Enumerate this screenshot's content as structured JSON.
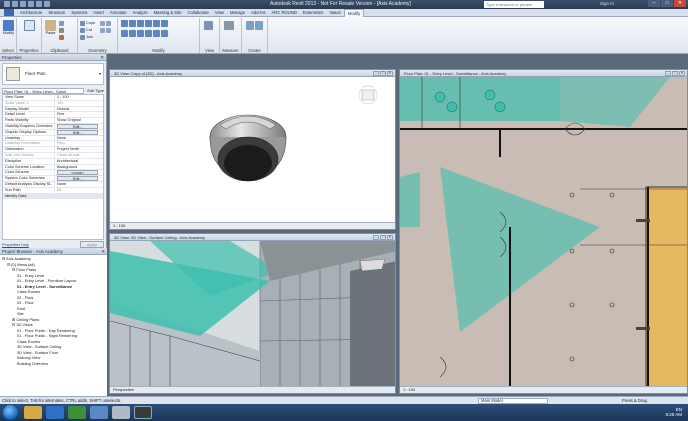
{
  "window": {
    "title": "Autodesk Revit 2013 - Not For Resale Version - [Axis Academy]",
    "search_placeholder": "Type a keyword or phrase",
    "sign_in": "Sign In",
    "close": "✕",
    "minimize": "–",
    "maximize": "□"
  },
  "tabs": [
    "Architecture",
    "Structure",
    "Systems",
    "Insert",
    "Annotate",
    "Analyze",
    "Massing & Site",
    "Collaborate",
    "View",
    "Manage",
    "Add-Ins",
    "ARC ROUND",
    "Extensions",
    "Vasari",
    "Modify"
  ],
  "active_tab": "Modify",
  "ribbon": {
    "select_label": "Select",
    "modify_label": "Modify",
    "properties_label": "Properties",
    "clipboard_label": "Clipboard",
    "geometry_label": "Geometry",
    "modify_group_label": "Modify",
    "view_label": "View",
    "measure_label": "Measure",
    "create_label": "Create",
    "copy_label": "Cope",
    "cut_label": "Cut",
    "join_label": "Join",
    "paste_label": "Paste"
  },
  "properties_panel": {
    "title": "Properties",
    "type_name": "Floor Plan",
    "instance_select": "Floor Plan: 01 - Entry Level - Surve",
    "edit_type": "Edit Type",
    "rows": [
      {
        "k": "View Scale",
        "v": "1 : 100",
        "dim": false
      },
      {
        "k": "Scale Value    1:",
        "v": "100",
        "dim": true
      },
      {
        "k": "Display Model",
        "v": "Normal",
        "dim": false
      },
      {
        "k": "Detail Level",
        "v": "Fine",
        "dim": false
      },
      {
        "k": "Parts Visibility",
        "v": "Show Original",
        "dim": false
      },
      {
        "k": "Visibility/Graphics Overrides",
        "v": "Edit...",
        "btn": true
      },
      {
        "k": "Graphic Display Options",
        "v": "Edit...",
        "btn": true
      },
      {
        "k": "Underlay",
        "v": "None",
        "dim": false
      },
      {
        "k": "Underlay Orientation",
        "v": "Plan",
        "dim": true
      },
      {
        "k": "Orientation",
        "v": "Project North",
        "dim": false
      },
      {
        "k": "Wall Join Display",
        "v": "Clean all wall ...",
        "dim": true
      },
      {
        "k": "Discipline",
        "v": "Architectural",
        "dim": false
      },
      {
        "k": "Color Scheme Location",
        "v": "Background",
        "dim": false
      },
      {
        "k": "Color Scheme",
        "v": "<none>",
        "btn": true
      },
      {
        "k": "System Color Schemes",
        "v": "Edit...",
        "btn": true
      },
      {
        "k": "Default Analysis Display St...",
        "v": "None",
        "dim": false
      },
      {
        "k": "Sun Path",
        "v": "☐",
        "dim": false
      }
    ],
    "section_label": "Identity Data",
    "help_link": "Properties help",
    "apply": "Apply"
  },
  "project_browser": {
    "title": "Project Browser - Axis Academy",
    "nodes": [
      {
        "label": "⊟ Axis Academy",
        "indent": 0
      },
      {
        "label": "⊟ [0] Views (all)",
        "indent": 1
      },
      {
        "label": "⊟ Floor Plans",
        "indent": 2
      },
      {
        "label": "01 - Entry Level",
        "indent": 3
      },
      {
        "label": "01 - Entry Level - Furniture Layout",
        "indent": 3
      },
      {
        "label": "01 - Entry Level - Surveillance",
        "indent": 3,
        "bold": true
      },
      {
        "label": "Class Rooms",
        "indent": 3
      },
      {
        "label": "02 - Floor",
        "indent": 3
      },
      {
        "label": "03 - Floor",
        "indent": 3
      },
      {
        "label": "Roof",
        "indent": 3
      },
      {
        "label": "Site",
        "indent": 3
      },
      {
        "label": "⊞ Ceiling Plans",
        "indent": 2
      },
      {
        "label": "⊟ 3D Views",
        "indent": 2
      },
      {
        "label": "01 - Floor Public - Day Rendering",
        "indent": 3
      },
      {
        "label": "01 - Floor Public - Night Rendering",
        "indent": 3
      },
      {
        "label": "Class Rooms",
        "indent": 3
      },
      {
        "label": "3D View - Surface Ceiling",
        "indent": 3
      },
      {
        "label": "3D View - Surface Floor",
        "indent": 3
      },
      {
        "label": "Balcony View",
        "indent": 3
      },
      {
        "label": "Building Overview",
        "indent": 3
      }
    ]
  },
  "views": {
    "v3d_title": "3D View: Copy of {3D} - Axis Academy",
    "v3d_scale": "1 : 100",
    "ceiling_title": "3D View: 3D View - Surface Ceiling - Axis Academy",
    "ceiling_mode": "Perspective",
    "plan_title": "Floor Plan: 01 - Entry Level - Surveillance - Axis Academy",
    "plan_scale": "1 : 100"
  },
  "statusbar": {
    "hint": "Click to select, TAB for alternates, CTRL adds, SHIFT unselects.",
    "model": "Main Model",
    "press_drag": "Press & Drag"
  },
  "taskbar": {
    "lang": "EN",
    "time": "9:25 AM"
  },
  "colors": {
    "teal_glass": "#3dbfae",
    "plan_floor": "#c9bcb5",
    "wood": "#e6b860"
  }
}
